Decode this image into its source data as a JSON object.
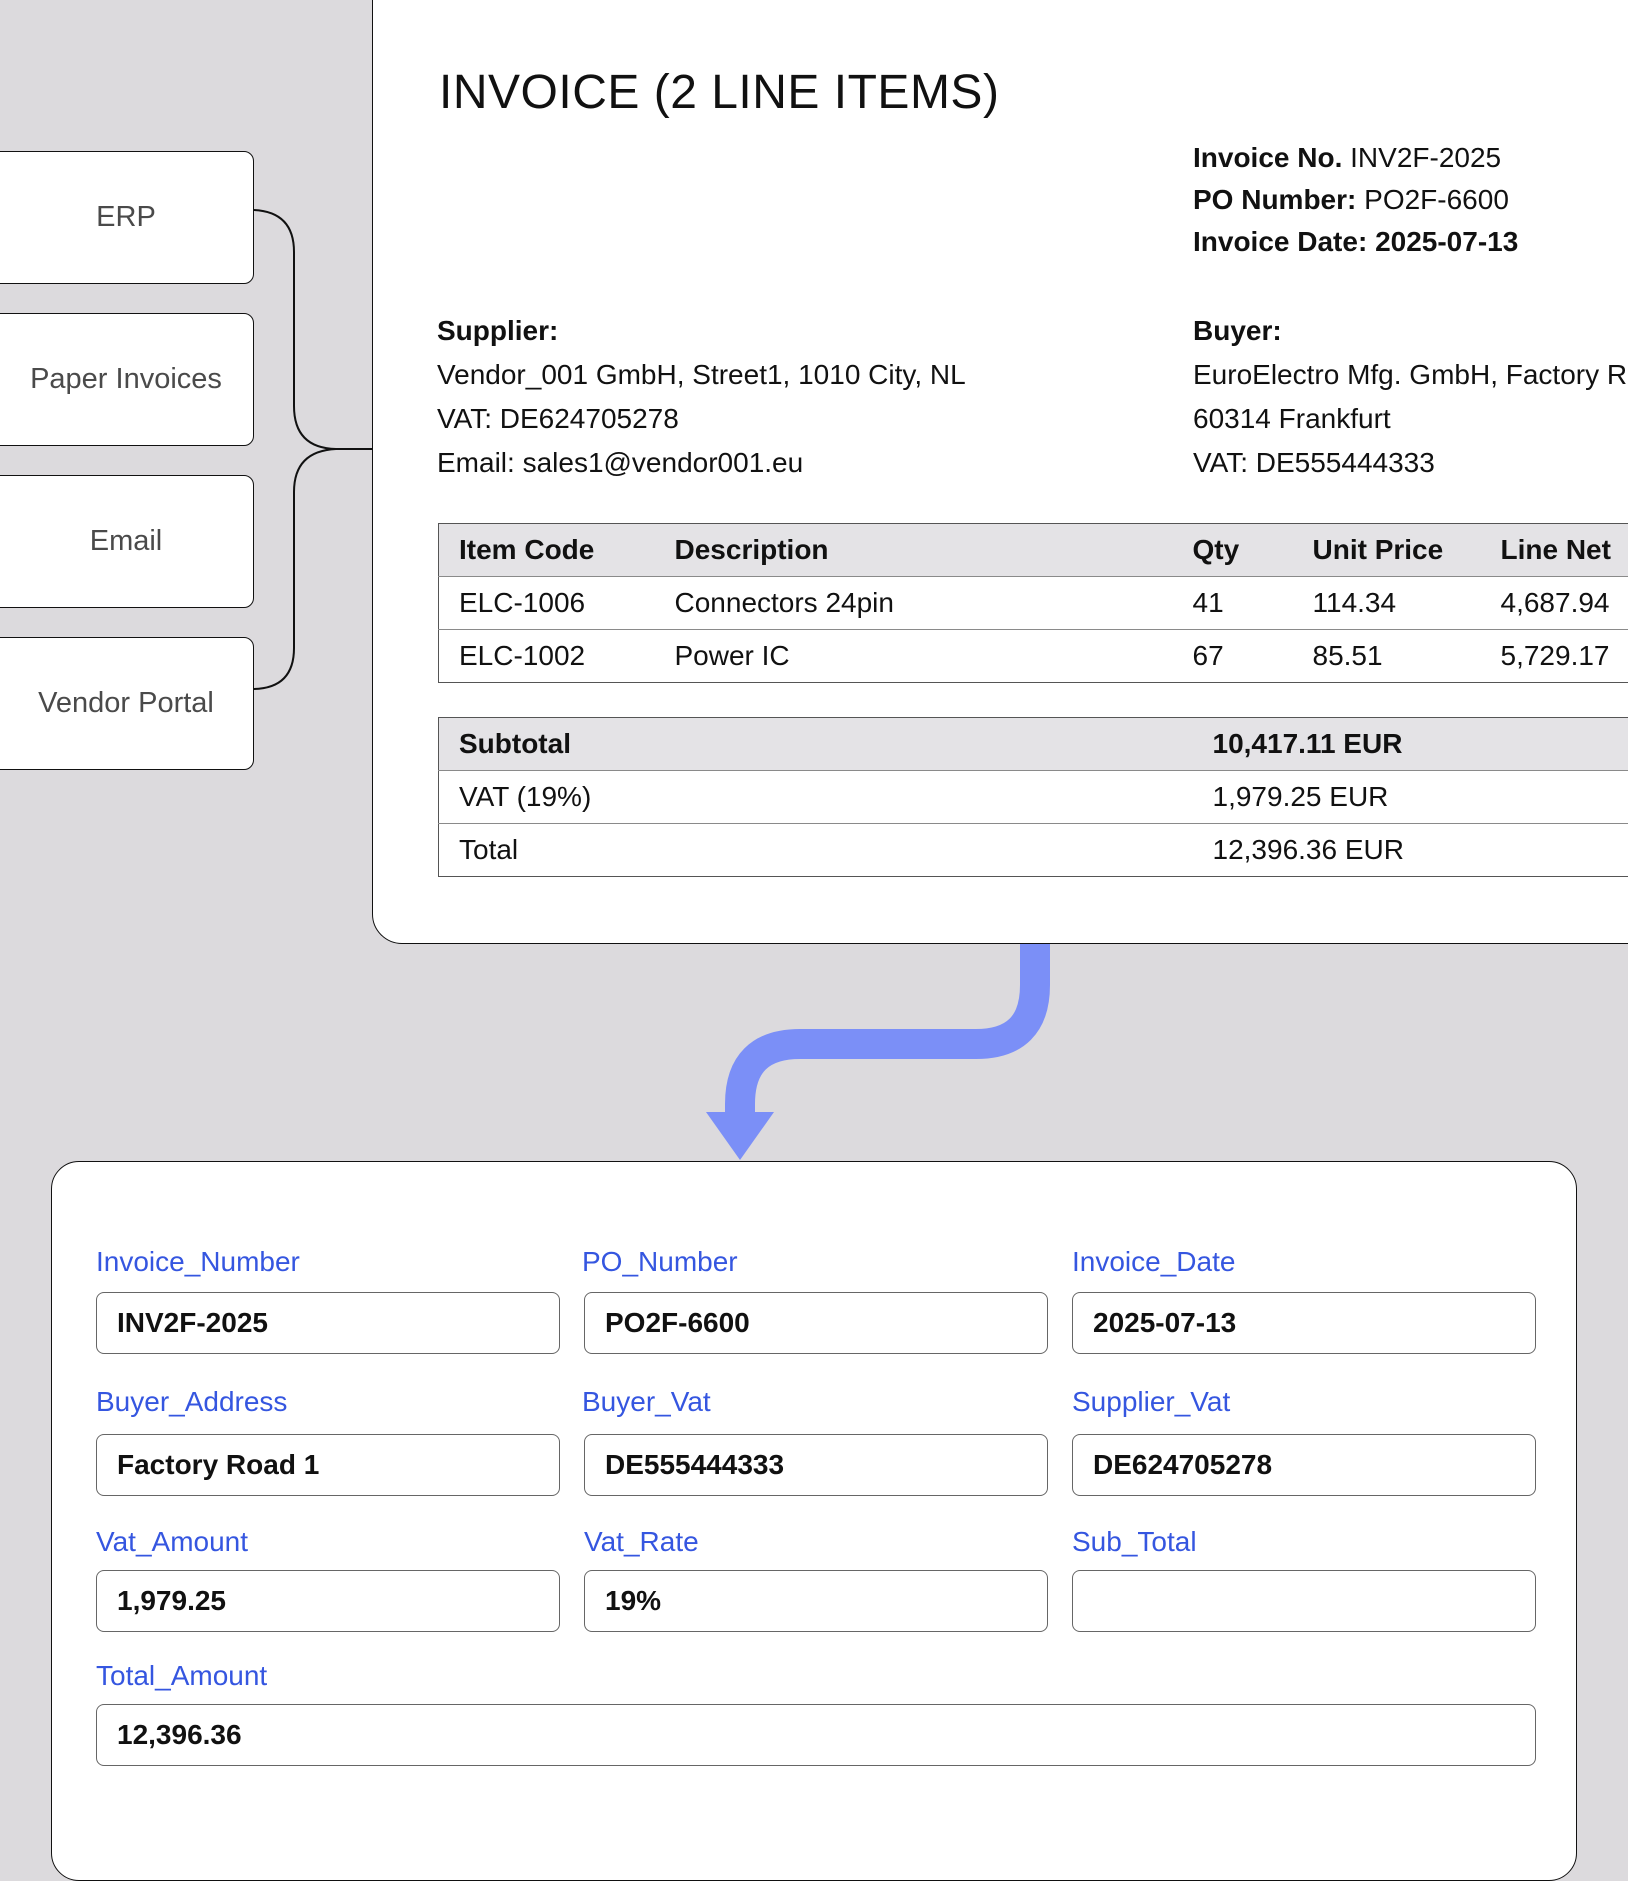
{
  "sources": [
    "ERP",
    "Paper Invoices",
    "Email",
    "Vendor Portal"
  ],
  "invoice": {
    "title": "INVOICE (2 LINE ITEMS)",
    "meta": {
      "invoice_no_label": "Invoice No.",
      "invoice_no": "INV2F-2025",
      "po_label": "PO Number:",
      "po_number": "PO2F-6600",
      "date_label": "Invoice Date:",
      "date": "2025-07-13"
    },
    "supplier": {
      "heading": "Supplier:",
      "line1": "Vendor_001 GmbH, Street1, 1010 City, NL",
      "line2": "VAT: DE624705278",
      "line3": "Email: sales1@vendor001.eu"
    },
    "buyer": {
      "heading": "Buyer:",
      "line1": "EuroElectro Mfg. GmbH, Factory R",
      "line2": "60314 Frankfurt",
      "line3": "VAT: DE555444333"
    },
    "items_table": {
      "headers": [
        "Item Code",
        "Description",
        "Qty",
        "Unit Price",
        "Line Net"
      ],
      "rows": [
        [
          "ELC-1006",
          "Connectors 24pin",
          "41",
          "114.34",
          "4,687.94"
        ],
        [
          "ELC-1002",
          "Power IC",
          "67",
          "85.51",
          "5,729.17"
        ]
      ]
    },
    "totals_table": [
      [
        "Subtotal",
        "10,417.11 EUR"
      ],
      [
        "VAT (19%)",
        "1,979.25 EUR"
      ],
      [
        "Total",
        "12,396.36 EUR"
      ]
    ]
  },
  "form": {
    "invoice_number": {
      "label": "Invoice_Number",
      "value": "INV2F-2025"
    },
    "po_number": {
      "label": "PO_Number",
      "value": "PO2F-6600"
    },
    "invoice_date": {
      "label": "Invoice_Date",
      "value": "2025-07-13"
    },
    "buyer_address": {
      "label": "Buyer_Address",
      "value": "Factory Road 1"
    },
    "buyer_vat": {
      "label": "Buyer_Vat",
      "value": "DE555444333"
    },
    "supplier_vat": {
      "label": "Supplier_Vat",
      "value": "DE624705278"
    },
    "vat_amount": {
      "label": "Vat_Amount",
      "value": "1,979.25"
    },
    "vat_rate": {
      "label": "Vat_Rate",
      "value": "19%"
    },
    "sub_total": {
      "label": "Sub_Total",
      "value": ""
    },
    "total_amount": {
      "label": "Total_Amount",
      "value": "12,396.36"
    }
  },
  "colors": {
    "background": "#dcdadd",
    "arrow": "#7b8ff7",
    "field_label": "#3556e0",
    "table_header": "#e4e3e6"
  }
}
